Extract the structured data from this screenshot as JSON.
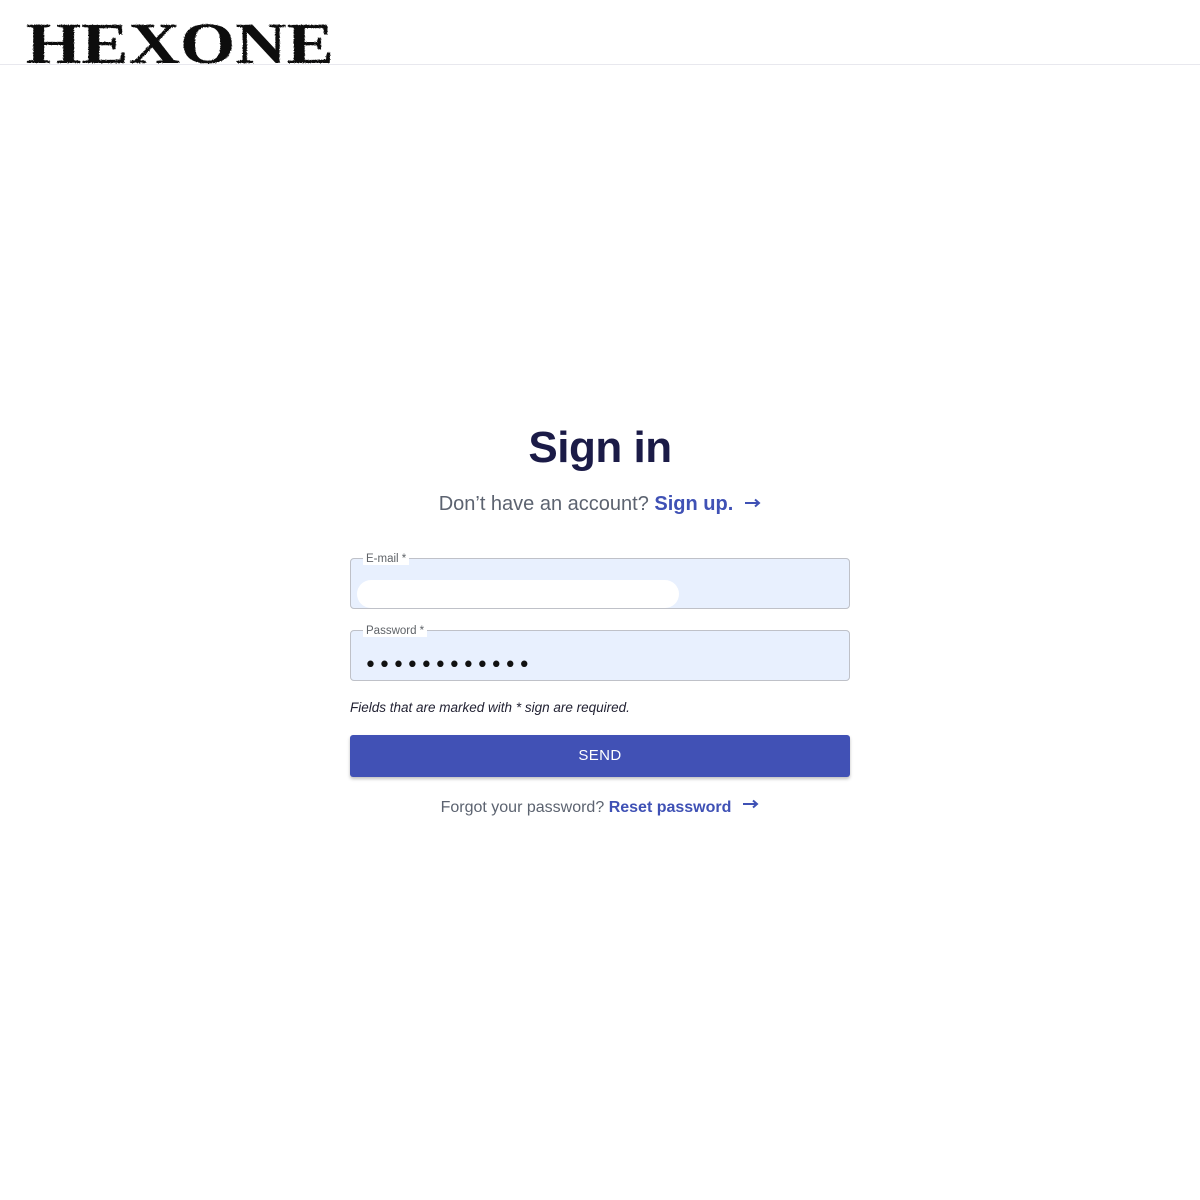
{
  "header": {
    "logo_text": "HEXONE"
  },
  "signin": {
    "title": "Sign in",
    "no_account_text": "Don’t have an account?",
    "signup_link": "Sign up.",
    "email_label": "E-mail *",
    "email_value": "",
    "password_label": "Password *",
    "password_value": "••••••••••••",
    "required_note": "Fields that are marked with * sign are required.",
    "send_label": "SEND",
    "forgot_text": "Forgot your password?",
    "reset_link": "Reset password"
  },
  "icons": {
    "arrow": "arrow-right-icon"
  },
  "colors": {
    "accent": "#3f51b5",
    "title": "#1b1b47",
    "field_background": "#e8f0fe"
  }
}
